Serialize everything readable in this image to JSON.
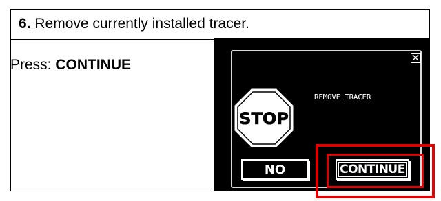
{
  "step": {
    "number": "6.",
    "text": " Remove currently installed tracer."
  },
  "instruction": {
    "prefix": "Press: ",
    "action": "CONTINUE"
  },
  "device": {
    "message": "REMOVE TRACER",
    "stop_sign_text": "STOP",
    "buttons": {
      "no": "NO",
      "continue": "CONTINUE"
    },
    "icons": {
      "close": "close-icon",
      "stop": "stop-sign-icon"
    }
  },
  "colors": {
    "highlight": "#e00000",
    "screen_bg": "#000000",
    "stop_sign": "#ffffff"
  }
}
